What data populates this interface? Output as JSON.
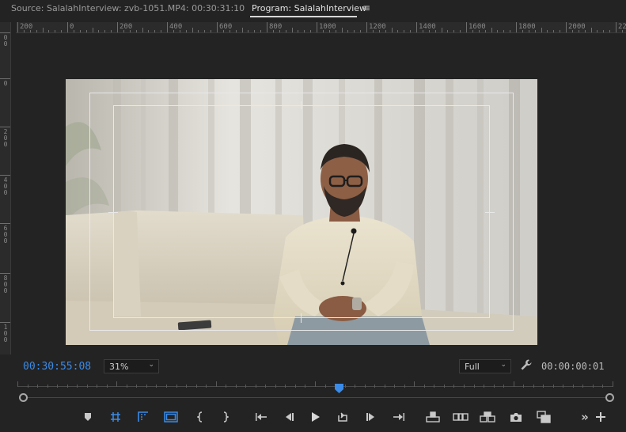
{
  "tabs": {
    "source": "Source: SalalahInterview: zvb-1051.MP4: 00:30:31:10",
    "program": "Program: SalalahInterview",
    "menu_icon": "hamburger-menu-icon"
  },
  "ruler": {
    "h_labels": [
      "200",
      "0",
      "200",
      "400",
      "600",
      "800",
      "1000",
      "1200",
      "1400",
      "1600",
      "1800",
      "2000",
      "22"
    ],
    "v_labels": [
      "00",
      "0",
      "200",
      "400",
      "600",
      "800",
      "100"
    ]
  },
  "monitor": {
    "timecode_current": "00:30:55:08",
    "zoom_level": "31%",
    "playback_resolution": "Full",
    "timecode_duration": "00:00:00:01",
    "settings_icon": "wrench-icon"
  },
  "timeline": {
    "playhead_fraction": 0.54
  },
  "transport": {
    "buttons": [
      "add-marker-icon",
      "safe-margins-icon",
      "mark-in-out-icon",
      "frame-icon",
      "mark-in-icon",
      "mark-out-icon",
      "go-to-in-icon",
      "step-back-icon",
      "play-icon",
      "loop-icon",
      "step-forward-icon",
      "go-to-out-icon",
      "lift-icon",
      "extract-icon",
      "comparison-view-icon",
      "export-frame-icon",
      "multi-camera-icon",
      "more-icon",
      "add-button-icon"
    ]
  },
  "colors": {
    "accent_blue": "#3b8be8",
    "panel_bg": "#232323"
  }
}
